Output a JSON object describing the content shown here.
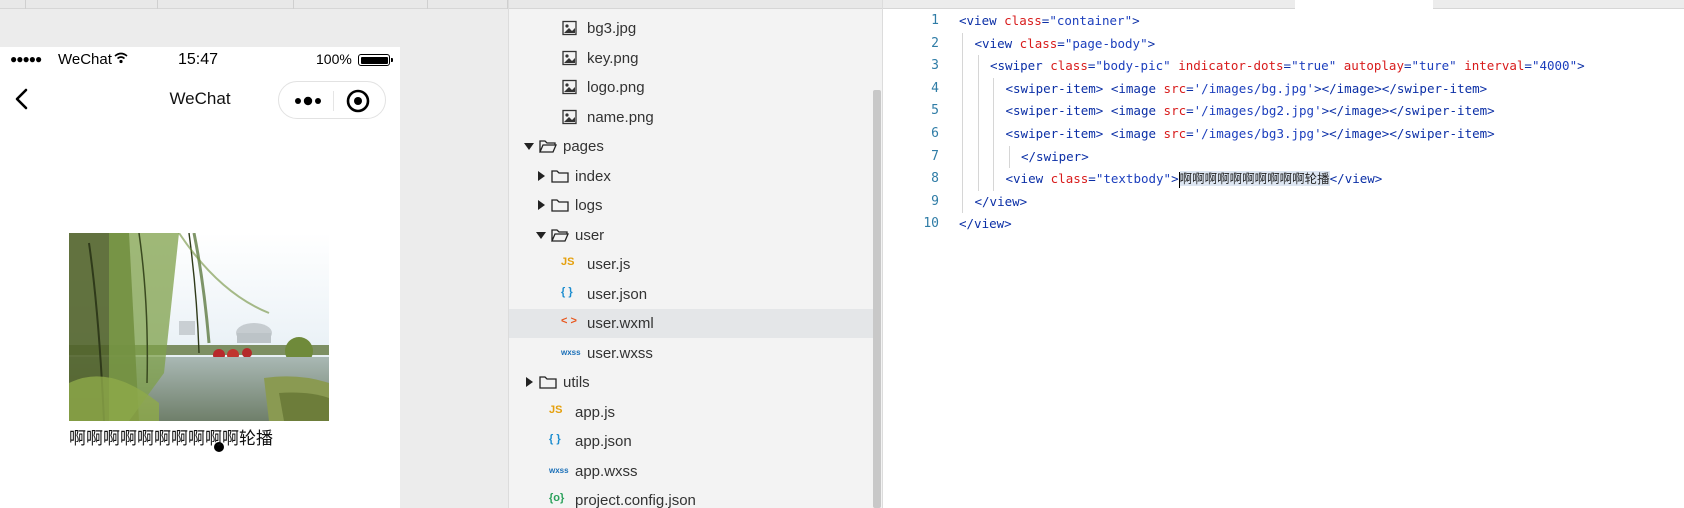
{
  "simulator": {
    "status_bar": {
      "signal": "●●●●●",
      "carrier": "WeChat",
      "time": "15:47",
      "battery_percent": "100%",
      "battery_level": 1.0
    },
    "nav": {
      "title": "WeChat"
    },
    "swiper": {
      "text": "啊啊啊啊啊啊啊啊啊啊轮播"
    }
  },
  "explorer": {
    "items": [
      {
        "label": "bg3.jpg",
        "type": "image"
      },
      {
        "label": "key.png",
        "type": "image"
      },
      {
        "label": "logo.png",
        "type": "image"
      },
      {
        "label": "name.png",
        "type": "image"
      },
      {
        "label": "pages",
        "type": "folder-open"
      },
      {
        "label": "index",
        "type": "folder"
      },
      {
        "label": "logs",
        "type": "folder"
      },
      {
        "label": "user",
        "type": "folder-open"
      },
      {
        "label": "user.js",
        "type": "js"
      },
      {
        "label": "user.json",
        "type": "json"
      },
      {
        "label": "user.wxml",
        "type": "wxml",
        "selected": true
      },
      {
        "label": "user.wxss",
        "type": "wxss"
      },
      {
        "label": "utils",
        "type": "folder"
      },
      {
        "label": "app.js",
        "type": "js"
      },
      {
        "label": "app.json",
        "type": "json"
      },
      {
        "label": "app.wxss",
        "type": "wxss"
      },
      {
        "label": "project.config.json",
        "type": "config"
      }
    ],
    "icon_text": {
      "js": "JS",
      "json": "{ }",
      "wxml": "< >",
      "wxss": "wxss",
      "config": "{o}"
    }
  },
  "editor": {
    "line_numbers": [
      "1",
      "2",
      "3",
      "4",
      "5",
      "6",
      "7",
      "8",
      "9",
      "10"
    ],
    "lines": [
      [
        [
          "tag",
          "<view "
        ],
        [
          "attr",
          "class"
        ],
        [
          "tag",
          "="
        ],
        [
          "str",
          "\"container\""
        ],
        [
          "tag",
          ">"
        ]
      ],
      [
        [
          "tag",
          "<view "
        ],
        [
          "attr",
          "class"
        ],
        [
          "tag",
          "="
        ],
        [
          "str",
          "\"page-body\""
        ],
        [
          "tag",
          ">"
        ]
      ],
      [
        [
          "tag",
          "<swiper "
        ],
        [
          "attr",
          "class"
        ],
        [
          "tag",
          "="
        ],
        [
          "str",
          "\"body-pic\""
        ],
        [
          "tag",
          " "
        ],
        [
          "attr",
          "indicator-dots"
        ],
        [
          "tag",
          "="
        ],
        [
          "str",
          "\"true\""
        ],
        [
          "tag",
          " "
        ],
        [
          "attr",
          "autoplay"
        ],
        [
          "tag",
          "="
        ],
        [
          "str",
          "\"ture\""
        ],
        [
          "tag",
          " "
        ],
        [
          "attr",
          "interval"
        ],
        [
          "tag",
          "="
        ],
        [
          "str",
          "\"4000\""
        ],
        [
          "tag",
          ">"
        ]
      ],
      [
        [
          "tag",
          "<swiper-item> <image "
        ],
        [
          "attr",
          "src"
        ],
        [
          "tag",
          "="
        ],
        [
          "str",
          "'/images/bg.jpg'"
        ],
        [
          "tag",
          "></image></swiper-item>"
        ]
      ],
      [
        [
          "tag",
          "<swiper-item> <image "
        ],
        [
          "attr",
          "src"
        ],
        [
          "tag",
          "="
        ],
        [
          "str",
          "'/images/bg2.jpg'"
        ],
        [
          "tag",
          "></image></swiper-item>"
        ]
      ],
      [
        [
          "tag",
          "<swiper-item> <image "
        ],
        [
          "attr",
          "src"
        ],
        [
          "tag",
          "="
        ],
        [
          "str",
          "'/images/bg3.jpg'"
        ],
        [
          "tag",
          "></image></swiper-item>"
        ]
      ],
      [
        [
          "tag",
          "</swiper>"
        ]
      ],
      [
        [
          "tag",
          "<view "
        ],
        [
          "attr",
          "class"
        ],
        [
          "tag",
          "="
        ],
        [
          "str",
          "\"textbody\""
        ],
        [
          "tag",
          ">"
        ],
        [
          "sel",
          "啊啊啊啊啊啊啊啊啊啊轮播"
        ],
        [
          "tag",
          "</view>"
        ]
      ],
      [
        [
          "tag",
          "</view>"
        ]
      ],
      [
        [
          "tag",
          "</view>"
        ]
      ]
    ],
    "indents": [
      0,
      1,
      2,
      3,
      3,
      3,
      4,
      3,
      1,
      0
    ]
  },
  "colors": {
    "tag": "#0b2fa6",
    "attr": "#d81b1b",
    "string": "#1c3fbd",
    "line_number": "#2f7ca6",
    "selected_row": "#e4e6e8"
  }
}
